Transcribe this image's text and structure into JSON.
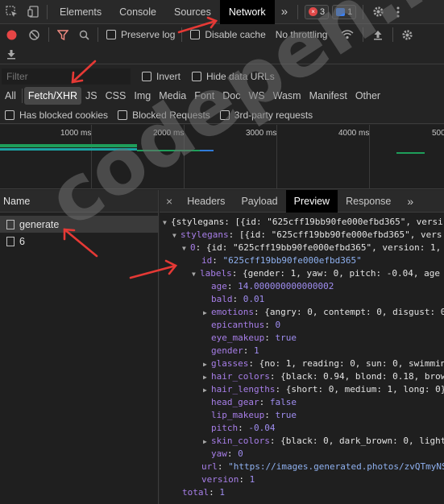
{
  "top_tabs": {
    "elements": "Elements",
    "console": "Console",
    "sources": "Sources",
    "network": "Network",
    "more": "»",
    "errors_count": "3",
    "messages_count": "1"
  },
  "toolbar": {
    "preserve_log": "Preserve log",
    "disable_cache": "Disable cache",
    "throttling": "No throttling"
  },
  "filter": {
    "placeholder": "Filter",
    "invert": "Invert",
    "hide_data_urls": "Hide data URLs"
  },
  "types": [
    "All",
    "Fetch/XHR",
    "JS",
    "CSS",
    "Img",
    "Media",
    "Font",
    "Doc",
    "WS",
    "Wasm",
    "Manifest",
    "Other"
  ],
  "blocked": {
    "has_blocked_cookies": "Has blocked cookies",
    "blocked_requests": "Blocked Requests",
    "third_party": "3rd-party requests"
  },
  "timeline": {
    "ticks": [
      "1000 ms",
      "2000 ms",
      "3000 ms",
      "4000 ms",
      "500"
    ]
  },
  "requests": {
    "header": "Name",
    "items": [
      "generate",
      "6"
    ]
  },
  "detail_tabs": {
    "close": "×",
    "headers": "Headers",
    "payload": "Payload",
    "preview": "Preview",
    "response": "Response",
    "more": "»"
  },
  "preview": {
    "line01": "{stylegans: [{id: \"625cff19bb90fe000efbd365\", versi",
    "line02_key": "stylegans",
    "line02_val": ": [{id: \"625cff19bb90fe000efbd365\", vers",
    "line03_key": "0",
    "line03_val": ": {id: \"625cff19bb90fe000efbd365\", version: 1,",
    "line04_key": "id",
    "line04_val": "\"625cff19bb90fe000efbd365\"",
    "line05_key": "labels",
    "line05_val": ": {gender: 1, yaw: 0, pitch: -0.04, age",
    "line06_key": "age",
    "line06_val": "14.000000000000002",
    "line07_key": "bald",
    "line07_val": "0.01",
    "line08_key": "emotions",
    "line08_val": ": {angry: 0, contempt: 0, disgust: 0",
    "line09_key": "epicanthus",
    "line09_val": "0",
    "line10_key": "eye_makeup",
    "line10_val": "true",
    "line11_key": "gender",
    "line11_val": "1",
    "line12_key": "glasses",
    "line12_val": ": {no: 1, reading: 0, sun: 0, swimmin",
    "line13_key": "hair_colors",
    "line13_val": ": {black: 0.94, blond: 0.18, brow",
    "line14_key": "hair_lengths",
    "line14_val": ": {short: 0, medium: 1, long: 0}",
    "line15_key": "head_gear",
    "line15_val": "false",
    "line16_key": "lip_makeup",
    "line16_val": "true",
    "line17_key": "pitch",
    "line17_val": "-0.04",
    "line18_key": "skin_colors",
    "line18_val": ": {black: 0, dark_brown: 0, light",
    "line19_key": "yaw",
    "line19_val": "0",
    "line20_key": "url",
    "line20_val": "\"https://images.generated.photos/zvQTmyNS",
    "line21_key": "version",
    "line21_val": "1",
    "line22_key": "total",
    "line22_val": "1"
  },
  "watermark": "codepen.net",
  "colors": {
    "accent_red": "#e53935",
    "active_tab_bg": "#000000",
    "timeline_green": "#1e9e5a",
    "timeline_blue": "#2f7bd8"
  }
}
